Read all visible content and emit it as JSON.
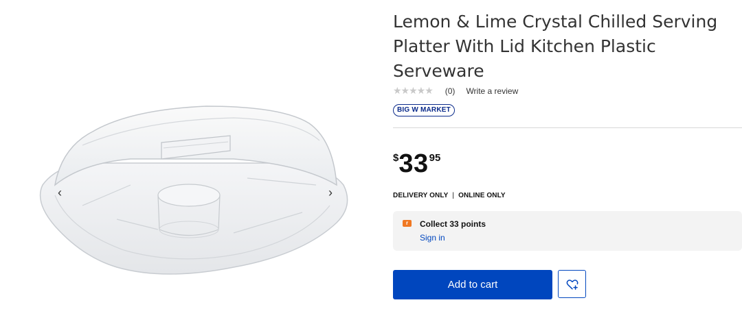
{
  "product": {
    "title": "Lemon & Lime Crystal Chilled Serving Platter With Lid Kitchen Plastic Serveware",
    "rating_stars": "★★★★★",
    "review_count": "(0)",
    "write_review": "Write a review",
    "badge": "BIG W MARKET",
    "price": {
      "currency": "$",
      "dollars": "33",
      "cents": "95"
    },
    "delivery_only": "DELIVERY ONLY",
    "online_only": "ONLINE ONLY",
    "delivery_separator": "|"
  },
  "rewards": {
    "icon_letter": "r",
    "collect_text": "Collect 33 points",
    "sign_in": "Sign in"
  },
  "actions": {
    "add_to_cart": "Add to cart"
  },
  "gallery": {
    "prev_arrow": "‹",
    "next_arrow": "›"
  },
  "colors": {
    "primary": "#0046be",
    "badge": "#0a2a8a",
    "rewards": "#f07822",
    "panel": "#f3f3f3"
  }
}
